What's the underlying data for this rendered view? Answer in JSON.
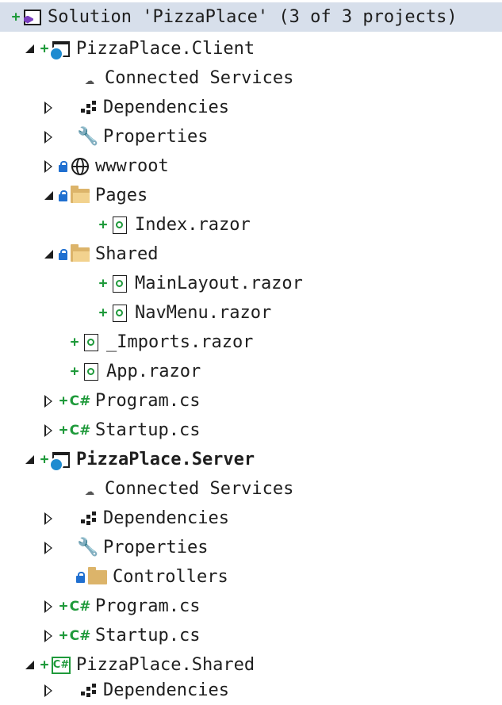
{
  "solution": {
    "label": "Solution 'PizzaPlace' (3 of 3 projects)"
  },
  "client": {
    "label": "PizzaPlace.Client",
    "connected_services": "Connected Services",
    "dependencies": "Dependencies",
    "properties": "Properties",
    "wwwroot": "wwwroot",
    "pages": "Pages",
    "index_razor": "Index.razor",
    "shared": "Shared",
    "mainlayout_razor": "MainLayout.razor",
    "navmenu_razor": "NavMenu.razor",
    "imports_razor": "_Imports.razor",
    "app_razor": "App.razor",
    "program_cs": "Program.cs",
    "startup_cs": "Startup.cs"
  },
  "server": {
    "label": "PizzaPlace.Server",
    "connected_services": "Connected Services",
    "dependencies": "Dependencies",
    "properties": "Properties",
    "controllers": "Controllers",
    "program_cs": "Program.cs",
    "startup_cs": "Startup.cs"
  },
  "shared_project": {
    "label": "PizzaPlace.Shared",
    "dependencies": "Dependencies"
  },
  "icons": {
    "cs_glyph": "C#",
    "plus_glyph": "+"
  },
  "colors": {
    "selection_bg": "#d7dfeb",
    "added_green": "#1f9a3b",
    "lock_blue": "#1f6fd0",
    "folder": "#dcb46a"
  }
}
